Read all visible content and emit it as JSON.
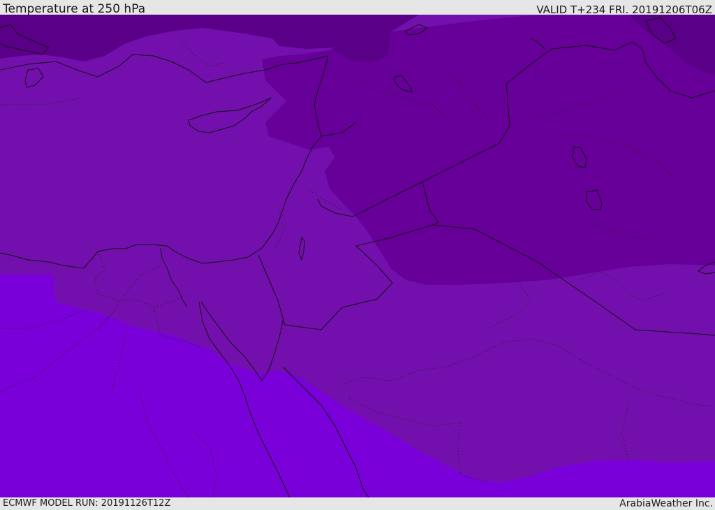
{
  "header": {
    "title": "Temperature at 250 hPa",
    "valid": "VALID T+234 FRI. 20191206T06Z"
  },
  "footer": {
    "model_run": "ECMWF MODEL RUN: 20191126T12Z",
    "credit": "ArabiaWeather Inc."
  },
  "map": {
    "colors": {
      "darkest": "#5a0088",
      "dark": "#660099",
      "medium": "#7310ad",
      "light": "#7a00d9",
      "coast": "#111111"
    }
  }
}
